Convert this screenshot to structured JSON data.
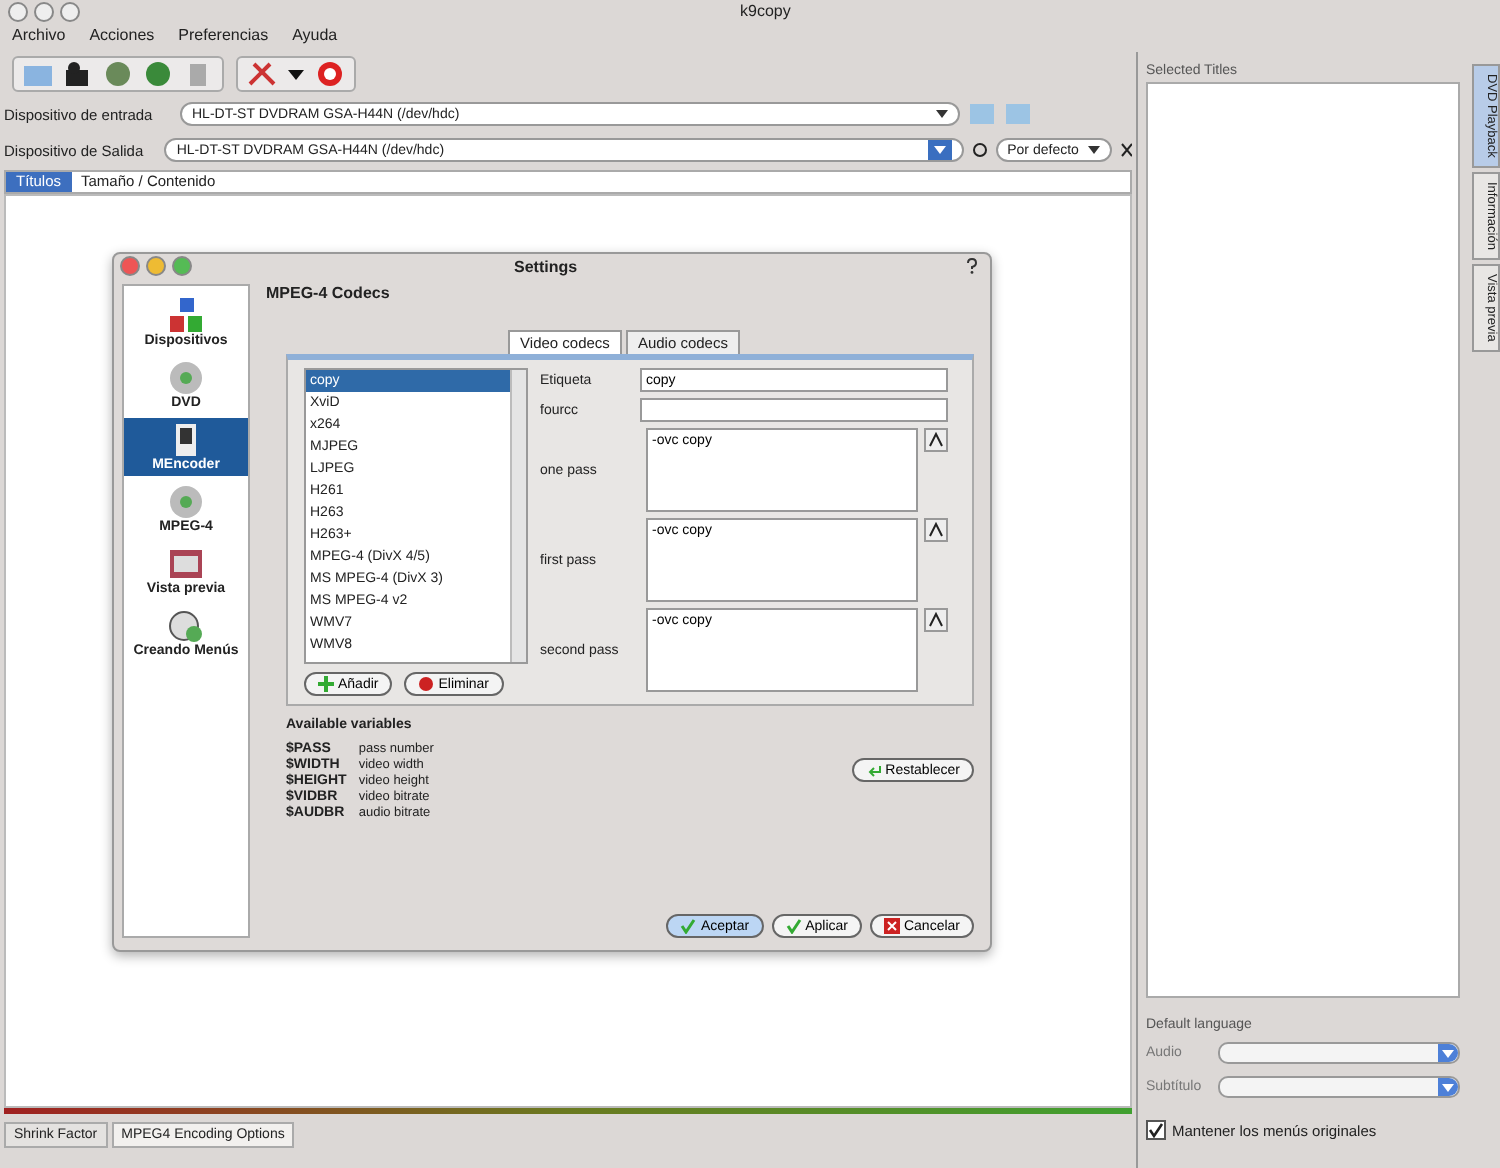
{
  "window": {
    "title": "k9copy"
  },
  "menu": [
    "Archivo",
    "Acciones",
    "Preferencias",
    "Ayuda"
  ],
  "input_device": {
    "label": "Dispositivo de entrada",
    "value": "HL-DT-ST DVDRAM GSA-H44N (/dev/hdc)"
  },
  "output_device": {
    "label": "Dispositivo de Salida",
    "value": "HL-DT-ST DVDRAM GSA-H44N (/dev/hdc)",
    "speed": "Por defecto"
  },
  "tabs": [
    {
      "label": "Títulos",
      "selected": true
    },
    {
      "label": "Tamaño / Contenido",
      "selected": false
    }
  ],
  "dialog": {
    "title": "Settings",
    "heading": "MPEG-4 Codecs",
    "sidebar": [
      {
        "label": "Dispositivos",
        "kind": "devices",
        "selected": false
      },
      {
        "label": "DVD",
        "kind": "disc",
        "selected": false
      },
      {
        "label": "MEncoder",
        "kind": "encoder",
        "selected": true
      },
      {
        "label": "MPEG-4",
        "kind": "disc",
        "selected": false
      },
      {
        "label": "Vista previa",
        "kind": "film",
        "selected": false
      },
      {
        "label": "Creando Menús",
        "kind": "menu",
        "selected": false
      }
    ],
    "tabs": [
      {
        "label": "Video codecs",
        "selected": true
      },
      {
        "label": "Audio codecs",
        "selected": false
      }
    ],
    "codecs": [
      {
        "name": "copy",
        "selected": true
      },
      {
        "name": "XviD",
        "selected": false
      },
      {
        "name": "x264",
        "selected": false
      },
      {
        "name": "MJPEG",
        "selected": false
      },
      {
        "name": "LJPEG",
        "selected": false
      },
      {
        "name": "H261",
        "selected": false
      },
      {
        "name": "H263",
        "selected": false
      },
      {
        "name": "H263+",
        "selected": false
      },
      {
        "name": "MPEG-4 (DivX 4/5)",
        "selected": false
      },
      {
        "name": "MS MPEG-4 (DivX 3)",
        "selected": false
      },
      {
        "name": "MS MPEG-4 v2",
        "selected": false
      },
      {
        "name": "WMV7",
        "selected": false
      },
      {
        "name": "WMV8",
        "selected": false
      }
    ],
    "label_field": {
      "label": "Etiqueta",
      "value": "copy"
    },
    "fourcc_field": {
      "label": "fourcc"
    },
    "passes": [
      {
        "label": "one pass",
        "value": "-ovc copy"
      },
      {
        "label": "first pass",
        "value": "-ovc copy"
      },
      {
        "label": "second pass",
        "value": "-ovc copy"
      }
    ],
    "add_button": "Añadir",
    "remove_button": "Eliminar",
    "variables_title": "Available variables",
    "variables": [
      {
        "name": "$PASS",
        "desc": "pass number"
      },
      {
        "name": "$WIDTH",
        "desc": "video width"
      },
      {
        "name": "$HEIGHT",
        "desc": "video height"
      },
      {
        "name": "$VIDBR",
        "desc": "video bitrate"
      },
      {
        "name": "$AUDBR",
        "desc": "audio bitrate"
      }
    ],
    "reset_button": "Restablecer",
    "buttons": [
      "Aceptar",
      "Aplicar",
      "Cancelar"
    ]
  },
  "right_panel": {
    "title": "Selected Titles",
    "side_tabs": [
      {
        "label": "DVD Playback",
        "selected": true
      },
      {
        "label": "Información",
        "selected": false
      },
      {
        "label": "Vista previa",
        "selected": false
      }
    ],
    "language_title": "Default language",
    "audio_label": "Audio",
    "subtitle_label": "Subtítulo",
    "keep_menus": {
      "label": "Mantener los menús originales",
      "checked": true
    }
  },
  "bottom_tabs": [
    {
      "label": "Shrink Factor",
      "selected": false
    },
    {
      "label": "MPEG4 Encoding Options",
      "selected": true
    }
  ]
}
